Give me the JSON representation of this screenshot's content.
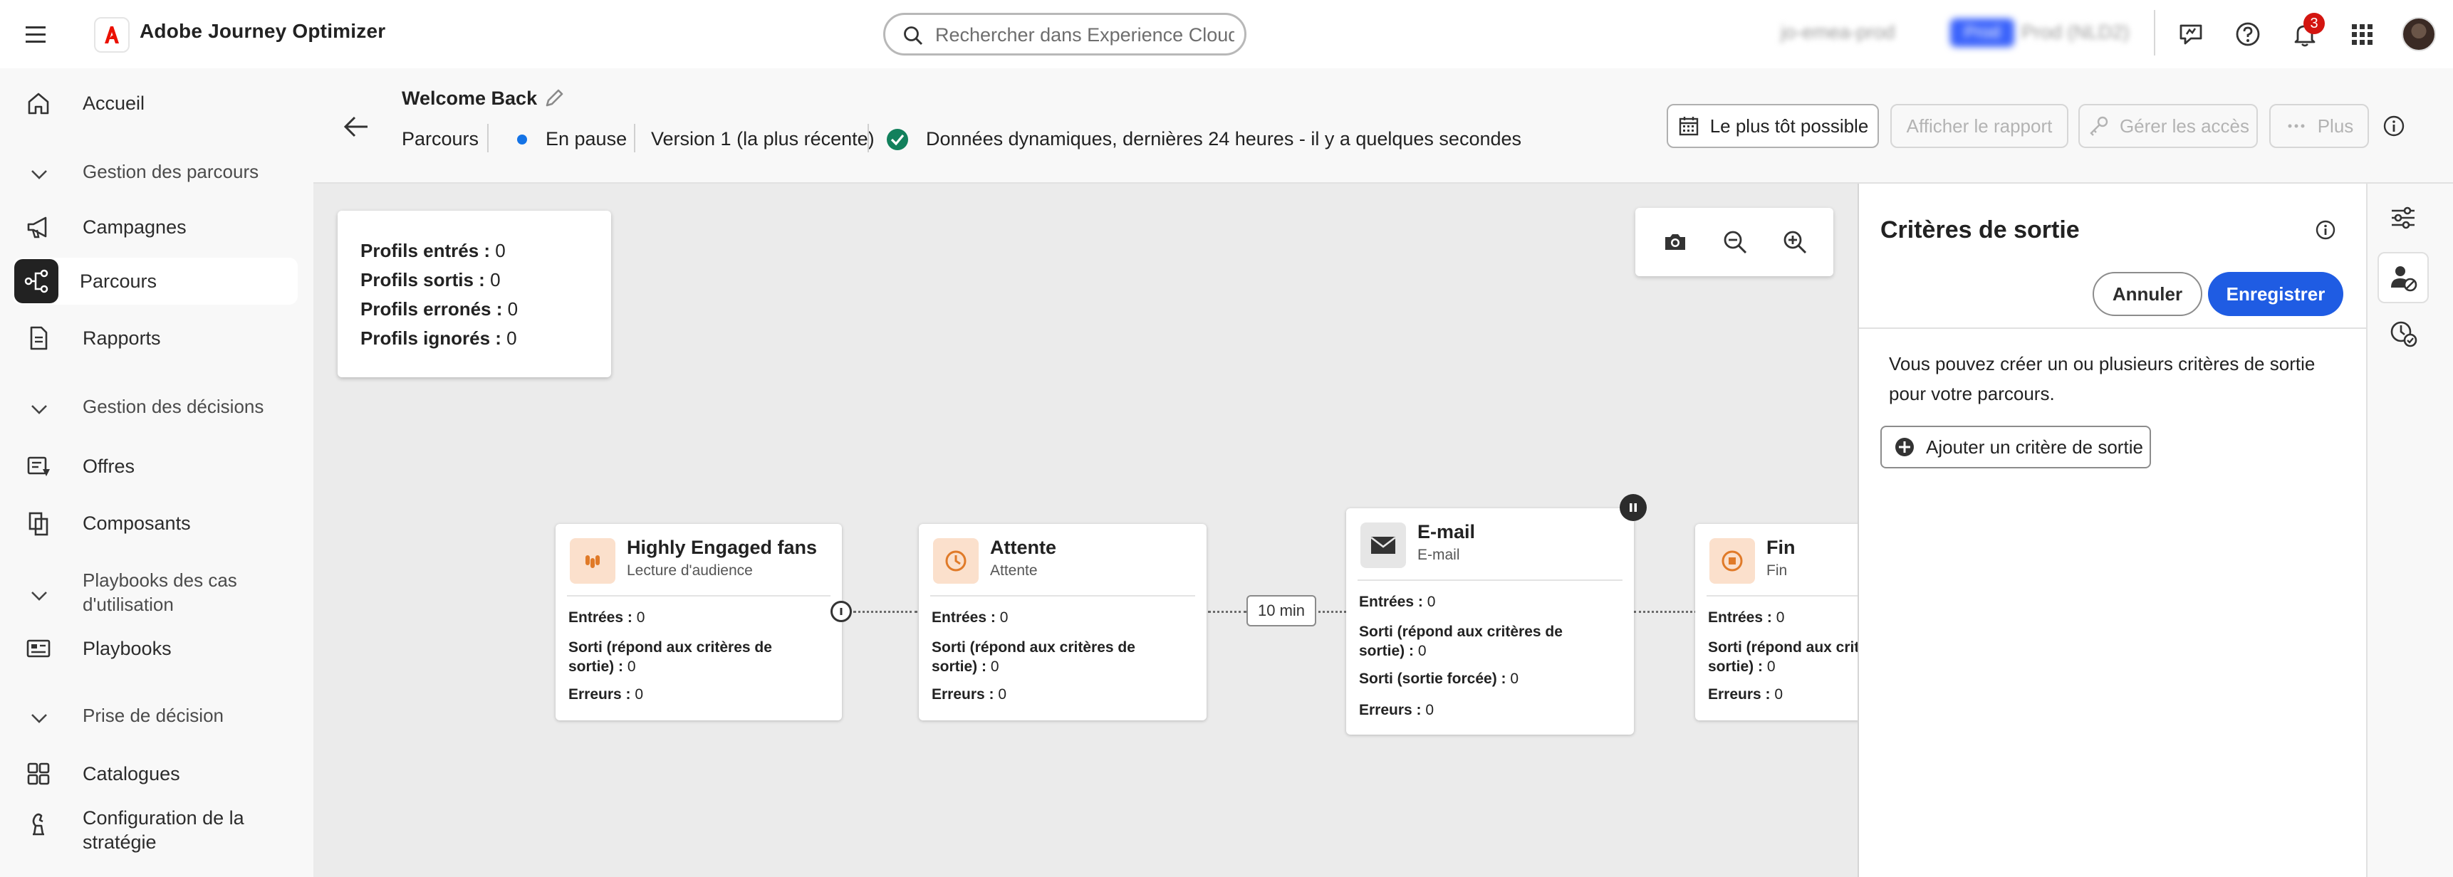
{
  "app": {
    "brand_name": "Adobe Journey Optimizer",
    "search_placeholder": "Rechercher dans Experience Cloud ...",
    "org_name": "jo-emea-prod",
    "sandbox_badge": "Prod",
    "sandbox_name": "Prod (NLD2)",
    "notification_count": "3",
    "accent_color": "#1f5ce3",
    "brand_color": "#eb1000"
  },
  "nav": {
    "items": [
      {
        "label": "Accueil",
        "icon": "home-icon"
      },
      {
        "label": "Gestion des parcours",
        "type": "section"
      },
      {
        "label": "Campagnes",
        "icon": "megaphone-icon"
      },
      {
        "label": "Parcours",
        "icon": "journey-icon",
        "active": true
      },
      {
        "label": "Rapports",
        "icon": "report-icon"
      },
      {
        "label": "Gestion des décisions",
        "type": "section"
      },
      {
        "label": "Offres",
        "icon": "offers-icon"
      },
      {
        "label": "Composants",
        "icon": "components-icon"
      },
      {
        "label": "Playbooks des cas d'utilisation",
        "type": "section"
      },
      {
        "label": "Playbooks",
        "icon": "playbook-icon"
      },
      {
        "label": "Prise de décision",
        "type": "section"
      },
      {
        "label": "Catalogues",
        "icon": "catalog-icon"
      },
      {
        "label": "Configuration de la stratégie",
        "icon": "strategy-icon"
      }
    ]
  },
  "journey": {
    "title": "Welcome Back",
    "breadcrumb": "Parcours",
    "status": "En pause",
    "status_color": "#1473e6",
    "version": "Version 1 (la plus récente)",
    "dynamic_data": "Données dynamiques, dernières 24 heures - il y a quelques secondes"
  },
  "header_buttons": {
    "schedule": "Le plus tôt possible",
    "report": "Afficher le rapport",
    "access": "Gérer les accès",
    "more": "Plus"
  },
  "stats": {
    "entered_label": "Profils entrés :",
    "entered_value": "0",
    "exited_label": "Profils sortis :",
    "exited_value": "0",
    "errored_label": "Profils erronés :",
    "errored_value": "0",
    "ignored_label": "Profils ignorés :",
    "ignored_value": "0"
  },
  "nodes": {
    "audience": {
      "title": "Highly Engaged fans",
      "subtitle": "Lecture d'audience",
      "entries_label": "Entrées :",
      "entries_value": "0",
      "exited_label_1": "Sorti (répond aux critères de",
      "exited_label_2": "sortie) :",
      "exited_value": "0",
      "errors_label": "Erreurs :",
      "errors_value": "0"
    },
    "wait": {
      "title": "Attente",
      "subtitle": "Attente",
      "entries_label": "Entrées :",
      "entries_value": "0",
      "exited_label_1": "Sorti (répond aux critères de",
      "exited_label_2": "sortie) :",
      "exited_value": "0",
      "errors_label": "Erreurs :",
      "errors_value": "0"
    },
    "wait_duration": "10 min",
    "email": {
      "title": "E-mail",
      "subtitle": "E-mail",
      "entries_label": "Entrées :",
      "entries_value": "0",
      "exited_label_1": "Sorti (répond aux critères de",
      "exited_label_2": "sortie) :",
      "exited_value": "0",
      "forced_label": "Sorti (sortie forcée) :",
      "forced_value": "0",
      "errors_label": "Erreurs :",
      "errors_value": "0"
    },
    "end": {
      "title": "Fin",
      "subtitle": "Fin",
      "entries_label": "Entrées :",
      "entries_value": "0",
      "exited_label_1": "Sorti (répond aux critères de",
      "exited_label_2": "sortie) :",
      "exited_value": "0",
      "errors_label": "Erreurs :",
      "errors_value": "0"
    }
  },
  "panel": {
    "title": "Critères de sortie",
    "cancel": "Annuler",
    "save": "Enregistrer",
    "description": "Vous pouvez créer un ou plusieurs critères de sortie pour votre parcours.",
    "add_button": "Ajouter un critère de sortie"
  }
}
